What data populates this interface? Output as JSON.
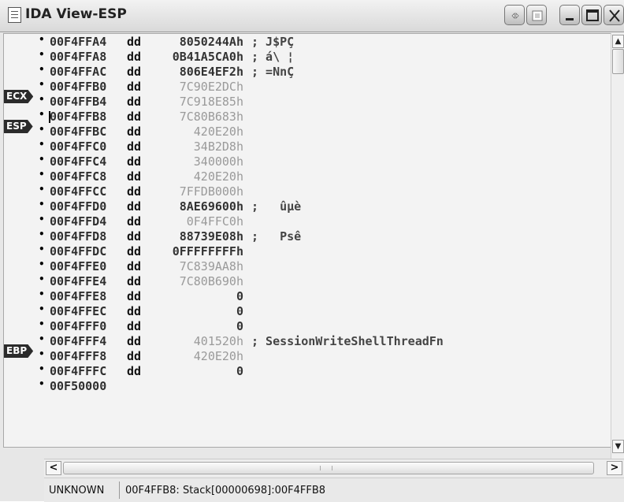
{
  "window": {
    "title": "IDA View-ESP"
  },
  "registers": {
    "ecx": "ECX",
    "esp": "ESP",
    "ebp": "EBP"
  },
  "rows": [
    {
      "addr": "00F4FFA4",
      "kw": "dd",
      "val": "8050244Ah",
      "style": "dark",
      "cmt": "; J$PÇ"
    },
    {
      "addr": "00F4FFA8",
      "kw": "dd",
      "val": "0B41A5CA0h",
      "style": "dark",
      "cmt": "; á\\ ¦"
    },
    {
      "addr": "00F4FFAC",
      "kw": "dd",
      "val": "806E4EF2h",
      "style": "dark",
      "cmt": "; =NnÇ"
    },
    {
      "addr": "00F4FFB0",
      "kw": "dd",
      "val": "7C90E2DCh",
      "style": "dim",
      "cmt": ""
    },
    {
      "addr": "00F4FFB4",
      "kw": "dd",
      "val": "7C918E85h",
      "style": "dim",
      "cmt": ""
    },
    {
      "addr": "00F4FFB8",
      "kw": "dd",
      "val": "7C80B683h",
      "style": "dim",
      "cmt": ""
    },
    {
      "addr": "00F4FFBC",
      "kw": "dd",
      "val": "420E20h",
      "style": "dim",
      "cmt": ""
    },
    {
      "addr": "00F4FFC0",
      "kw": "dd",
      "val": "34B2D8h",
      "style": "dim",
      "cmt": ""
    },
    {
      "addr": "00F4FFC4",
      "kw": "dd",
      "val": "340000h",
      "style": "dim",
      "cmt": ""
    },
    {
      "addr": "00F4FFC8",
      "kw": "dd",
      "val": "420E20h",
      "style": "dim",
      "cmt": ""
    },
    {
      "addr": "00F4FFCC",
      "kw": "dd",
      "val": "7FFDB000h",
      "style": "dim",
      "cmt": ""
    },
    {
      "addr": "00F4FFD0",
      "kw": "dd",
      "val": "8AE69600h",
      "style": "dark",
      "cmt": ";   ûµè"
    },
    {
      "addr": "00F4FFD4",
      "kw": "dd",
      "val": "0F4FFC0h",
      "style": "dim",
      "cmt": ""
    },
    {
      "addr": "00F4FFD8",
      "kw": "dd",
      "val": "88739E08h",
      "style": "dark",
      "cmt": ";   Psê"
    },
    {
      "addr": "00F4FFDC",
      "kw": "dd",
      "val": "0FFFFFFFFh",
      "style": "dark",
      "cmt": ""
    },
    {
      "addr": "00F4FFE0",
      "kw": "dd",
      "val": "7C839AA8h",
      "style": "dim",
      "cmt": ""
    },
    {
      "addr": "00F4FFE4",
      "kw": "dd",
      "val": "7C80B690h",
      "style": "dim",
      "cmt": ""
    },
    {
      "addr": "00F4FFE8",
      "kw": "dd",
      "val": "0",
      "style": "dark",
      "cmt": ""
    },
    {
      "addr": "00F4FFEC",
      "kw": "dd",
      "val": "0",
      "style": "dark",
      "cmt": ""
    },
    {
      "addr": "00F4FFF0",
      "kw": "dd",
      "val": "0",
      "style": "dark",
      "cmt": ""
    },
    {
      "addr": "00F4FFF4",
      "kw": "dd",
      "val": "401520h",
      "style": "dim",
      "cmt": "; SessionWriteShellThreadFn"
    },
    {
      "addr": "00F4FFF8",
      "kw": "dd",
      "val": "420E20h",
      "style": "dim",
      "cmt": ""
    },
    {
      "addr": "00F4FFFC",
      "kw": "dd",
      "val": "0",
      "style": "dark",
      "cmt": ""
    },
    {
      "addr": "00F50000",
      "kw": "",
      "val": "",
      "style": "dark",
      "cmt": ""
    }
  ],
  "status": {
    "mode": "UNKNOWN",
    "location": "00F4FFB8: Stack[00000698]:00F4FFB8"
  },
  "icons": {
    "title": "document-icon",
    "nav": "navigate-icon",
    "restore": "restore-icon",
    "minimize": "minimize-icon",
    "maximize": "maximize-icon",
    "close": "close-icon"
  }
}
